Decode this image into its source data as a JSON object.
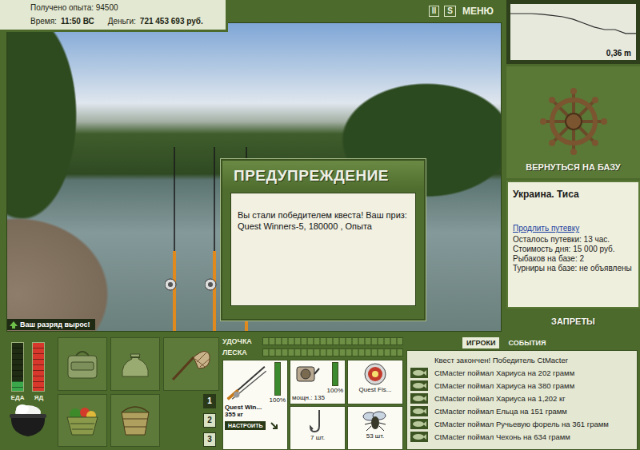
{
  "header": {
    "experience": "Получено опыта: 94500",
    "time_label": "Время:",
    "time": "11:50 ВС",
    "money_label": "Деньги:",
    "money": "721 453 693 руб."
  },
  "top_buttons": [
    {
      "label": "II",
      "kind": "icon"
    },
    {
      "label": "S",
      "kind": "icon"
    },
    {
      "label": "МЕНЮ",
      "kind": "text"
    }
  ],
  "depth_chart": {
    "reading": "0,36 m",
    "values": [
      0.05,
      0.05,
      0.05,
      0.06,
      0.08,
      0.1,
      0.14,
      0.2,
      0.26,
      0.3,
      0.3,
      0.36,
      0.36
    ]
  },
  "base_button": "ВЕРНУТЬСЯ НА БАЗУ",
  "location": {
    "title": "Украина. Тиса",
    "link": "Продлить путевку",
    "details": [
      "Осталось путевки: 13 час.",
      "Стоимость дня: 15 000 руб.",
      "Рыбаков на базе: 2",
      "Турниры на базе: не объявлены"
    ]
  },
  "bans_button": "ЗАПРЕТЫ",
  "dialog": {
    "title": "ПРЕДУПРЕЖДЕНИЕ",
    "message": "Вы стали победителем квеста! Ваш приз: Quest Winners-5, 180000 , Опыта"
  },
  "toast": "Ваш разряд вырос!",
  "meters": [
    {
      "label": "ЕДА",
      "level": 0.2,
      "color": "#3aa84a"
    },
    {
      "label": "ЯД",
      "level": 1,
      "color": "#d8382c"
    }
  ],
  "inventory_pages": [
    {
      "label": "1",
      "selected": true
    },
    {
      "label": "2",
      "selected": false
    },
    {
      "label": "3",
      "selected": false
    }
  ],
  "tackle_bars": [
    {
      "label": "УДОЧКА",
      "level": 0
    },
    {
      "label": "ЛЕСКА",
      "level": 0
    }
  ],
  "tackle": {
    "rod": {
      "name": "Quest Win...",
      "weight": "355 кг",
      "condition": "100%",
      "level": 1
    },
    "setup_button": "НАСТРОИТЬ",
    "reel": {
      "power": "мощн.: 135",
      "condition": "100%",
      "level": 1
    },
    "line": {
      "name": "Quest Fis..."
    },
    "hook": {
      "count": "7 шт."
    },
    "bait": {
      "count": "53 шт."
    }
  },
  "events": {
    "tabs": [
      {
        "label": "ИГРОКИ",
        "selected": true
      },
      {
        "label": "СОБЫТИЯ",
        "selected": false
      }
    ],
    "items": [
      {
        "text": "Квест закончен! Победитель CtMacter",
        "kind": "notice"
      },
      {
        "text": "CtMacter поймал Хариуса на 202 грамм",
        "kind": "catch"
      },
      {
        "text": "CtMacter поймал Хариуса на 380 грамм",
        "kind": "catch"
      },
      {
        "text": "CtMacter поймал Хариуса на 1,202 кг",
        "kind": "catch"
      },
      {
        "text": "CtMacter поймал Ельца на 151 грамм",
        "kind": "catch"
      },
      {
        "text": "CtMacter поймал Ручьевую форель на 361 грамм",
        "kind": "catch"
      },
      {
        "text": "CtMacter поймал Чехонь на 634 грамм",
        "kind": "catch"
      }
    ]
  }
}
